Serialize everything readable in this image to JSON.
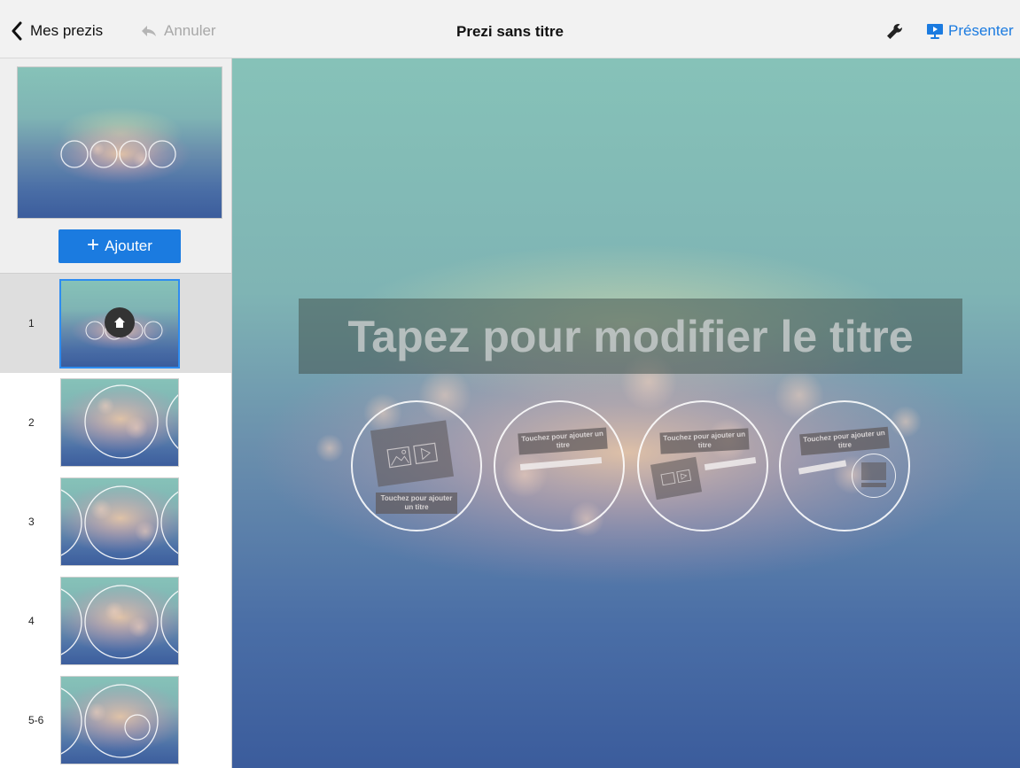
{
  "header": {
    "back_label": "Mes prezis",
    "undo_label": "Annuler",
    "document_title": "Prezi sans titre",
    "present_label": "Présenter",
    "icons": {
      "back": "chevron-left-icon",
      "undo": "undo-arrow-icon",
      "settings": "wrench-icon",
      "present": "present-screen-icon"
    }
  },
  "sidebar": {
    "add_button_label": "Ajouter",
    "slides": [
      {
        "number": "1",
        "selected": true
      },
      {
        "number": "2",
        "selected": false
      },
      {
        "number": "3",
        "selected": false
      },
      {
        "number": "4",
        "selected": false
      },
      {
        "number": "5-6",
        "selected": false
      }
    ]
  },
  "canvas": {
    "title_placeholder": "Tapez pour modifier le titre",
    "topics": [
      {
        "label": "Touchez pour ajouter un titre"
      },
      {
        "label": "Touchez pour ajouter un titre"
      },
      {
        "label": "Touchez pour ajouter un titre"
      },
      {
        "label": "Touchez pour ajouter un titre"
      }
    ]
  },
  "colors": {
    "accent": "#1b7be0",
    "selection_border": "#2e8cf0",
    "topbar_bg": "#f2f2f2",
    "canvas_top": "#86c2b8",
    "canvas_bottom": "#3b5f9e"
  }
}
